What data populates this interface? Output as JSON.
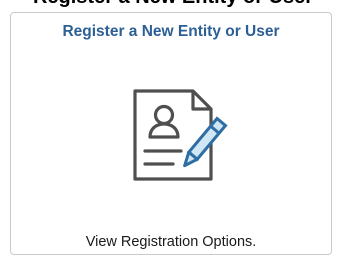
{
  "header": {
    "partial_heading": "Register a New Entity or User"
  },
  "tile": {
    "title": "Register a New Entity or User",
    "icon": "registration-form-pencil-icon",
    "footer": "View Registration Options."
  },
  "colors": {
    "title": "#2c5f95",
    "icon_stroke": "#4f4f4f",
    "pencil_fill": "#cfe6f5",
    "pencil_stroke": "#2f6da3",
    "border": "#c9c9c9"
  }
}
